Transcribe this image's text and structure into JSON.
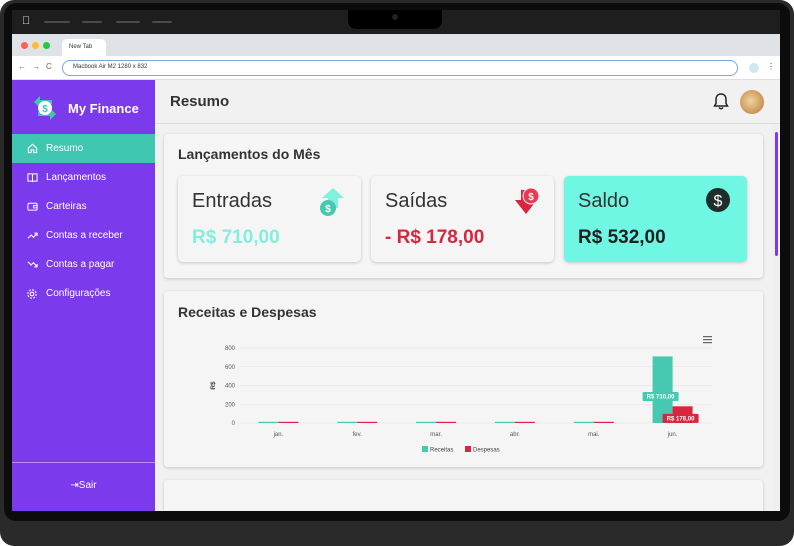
{
  "browser": {
    "tab_title": "New Tab",
    "url_text": "Macbook Air M2   1280 x 832"
  },
  "app": {
    "brand": "My Finance",
    "nav": [
      {
        "label": "Resumo",
        "icon": "home-icon",
        "active": true
      },
      {
        "label": "Lançamentos",
        "icon": "book-icon",
        "active": false
      },
      {
        "label": "Carteiras",
        "icon": "wallet-icon",
        "active": false
      },
      {
        "label": "Contas a receber",
        "icon": "trend-up-icon",
        "active": false
      },
      {
        "label": "Contas a pagar",
        "icon": "trend-down-icon",
        "active": false
      },
      {
        "label": "Configurações",
        "icon": "gear-icon",
        "active": false
      }
    ],
    "logout_label": "Sair"
  },
  "header": {
    "title": "Resumo"
  },
  "summary": {
    "title": "Lançamentos do Mês",
    "cards": [
      {
        "label": "Entradas",
        "value": "R$ 710,00",
        "color": "#7ef0dc",
        "icon": "money-up-icon"
      },
      {
        "label": "Saídas",
        "value": "- R$ 178,00",
        "color": "#d7263d",
        "icon": "money-down-icon"
      },
      {
        "label": "Saldo",
        "value": "R$ 532,00",
        "color": "#1f1f1f",
        "icon": "dollar-icon"
      }
    ]
  },
  "chart_section": {
    "title": "Receitas e Despesas"
  },
  "chart_data": {
    "type": "bar",
    "categories": [
      "jan.",
      "fev.",
      "mar.",
      "abr.",
      "mai.",
      "jun."
    ],
    "series": [
      {
        "name": "Receitas",
        "values": [
          0,
          0,
          0,
          0,
          0,
          710
        ],
        "color": "#46c9b0"
      },
      {
        "name": "Despesas",
        "values": [
          0,
          0,
          0,
          0,
          0,
          178
        ],
        "color": "#d7263d"
      }
    ],
    "data_labels": [
      "R$ 710,00",
      "R$ 178,00"
    ],
    "ylabel": "R$",
    "yticks": [
      0,
      200,
      400,
      600,
      800
    ],
    "ylim": [
      0,
      800
    ],
    "grid": true,
    "legend": "bottom-center"
  },
  "colors": {
    "sidebar": "#7c3aed",
    "active_nav": "#3ec6b0",
    "saldo_card": "#6ff7e3"
  }
}
